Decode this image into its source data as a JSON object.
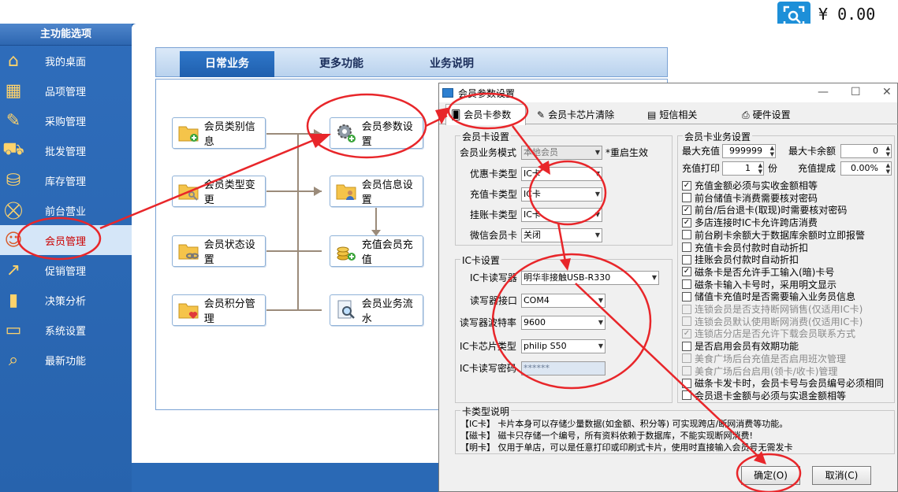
{
  "topbar": {
    "balance": "¥ 0.00"
  },
  "sidebar": {
    "title": "主功能选项",
    "items": [
      {
        "label": "我的桌面",
        "icon": "house-icon"
      },
      {
        "label": "品项管理",
        "icon": "building-icon"
      },
      {
        "label": "采购管理",
        "icon": "purchase-icon"
      },
      {
        "label": "批发管理",
        "icon": "truck-icon"
      },
      {
        "label": "库存管理",
        "icon": "database-icon"
      },
      {
        "label": "前台营业",
        "icon": "cart-icon"
      },
      {
        "label": "会员管理",
        "icon": "member-icon"
      },
      {
        "label": "促销管理",
        "icon": "promotion-icon"
      },
      {
        "label": "决策分析",
        "icon": "bar-chart-icon"
      },
      {
        "label": "系统设置",
        "icon": "computer-icon"
      },
      {
        "label": "最新功能",
        "icon": "document-search-icon"
      }
    ]
  },
  "main": {
    "tabs": [
      "日常业务",
      "更多功能",
      "业务说明"
    ],
    "buttons": [
      "会员类别信息",
      "会员类型变更",
      "会员状态设置",
      "会员积分管理",
      "会员参数设置",
      "会员信息设置",
      "充值会员充值",
      "会员业务流水"
    ]
  },
  "dialog": {
    "title": "会员参数设置",
    "tabs": [
      "会员卡参数",
      "会员卡芯片清除",
      "短信相关",
      "硬件设置"
    ],
    "card_settings": {
      "legend": "会员卡设置",
      "mode_label": "会员业务模式",
      "mode_value": "本地会员",
      "restart_note": "*重启生效",
      "discount_label": "优惠卡类型",
      "discount_value": "IC卡",
      "recharge_label": "充值卡类型",
      "recharge_value": "IC卡",
      "credit_label": "挂账卡类型",
      "credit_value": "IC卡",
      "wechat_label": "微信会员卡",
      "wechat_value": "关闭"
    },
    "ic_settings": {
      "legend": "IC卡设置",
      "reader_label": "IC卡读写器",
      "reader_value": "明华非接触USB-R330",
      "port_label": "读写器接口",
      "port_value": "COM4",
      "baud_label": "读写器波特率",
      "baud_value": "9600",
      "chip_label": "IC卡芯片类型",
      "chip_value": "philip S50",
      "password_label": "IC卡读写密码",
      "password_value": "******"
    },
    "business": {
      "legend": "会员卡业务设置",
      "max_recharge_label": "最大充值",
      "max_recharge_value": "999999",
      "max_balance_label": "最大卡余额",
      "max_balance_value": "0",
      "print_label": "充值打印",
      "print_value": "1",
      "print_unit": "份",
      "commission_label": "充值提成",
      "commission_value": "0.00%"
    },
    "checkboxes": [
      {
        "label": "充值金额必须与实收金额相等",
        "checked": true,
        "disabled": false
      },
      {
        "label": "前台储值卡消费需要核对密码",
        "checked": false,
        "disabled": false
      },
      {
        "label": "前台/后台退卡(取现)时需要核对密码",
        "checked": true,
        "disabled": false
      },
      {
        "label": "多店连接时IC卡允许跨店消费",
        "checked": true,
        "disabled": false
      },
      {
        "label": "前台刷卡余额大于数据库余额时立即报警",
        "checked": false,
        "disabled": false
      },
      {
        "label": "充值卡会员付款时自动折扣",
        "checked": false,
        "disabled": false
      },
      {
        "label": "挂账会员付款时自动折扣",
        "checked": false,
        "disabled": false
      },
      {
        "label": "磁条卡是否允许手工输入(暗)卡号",
        "checked": true,
        "disabled": false
      },
      {
        "label": "磁条卡输入卡号时，采用明文显示",
        "checked": false,
        "disabled": false
      },
      {
        "label": "储值卡充值时是否需要输入业务员信息",
        "checked": false,
        "disabled": false
      },
      {
        "label": "连锁会员是否支持断网销售(仅适用IC卡)",
        "checked": false,
        "disabled": true
      },
      {
        "label": "连锁会员默认使用断网消费(仅适用IC卡)",
        "checked": false,
        "disabled": true
      },
      {
        "label": "连锁店分店是否允许下载会员联系方式",
        "checked": true,
        "disabled": true
      },
      {
        "label": "是否启用会员有效期功能",
        "checked": false,
        "disabled": false
      },
      {
        "label": "美食广场后台充值是否启用班次管理",
        "checked": false,
        "disabled": true
      },
      {
        "label": "美食广场后台启用(领卡/收卡)管理",
        "checked": false,
        "disabled": true
      },
      {
        "label": "磁条卡发卡时，会员卡号与会员编号必须相同",
        "checked": false,
        "disabled": false
      },
      {
        "label": "会员退卡金额与必须与实退金额相等",
        "checked": false,
        "disabled": false
      }
    ],
    "card_desc": {
      "legend": "卡类型说明",
      "lines": [
        "【IC卡】 卡片本身可以存储少量数据(如金额、积分等) 可实现跨店/断网消费等功能。",
        "【磁卡】 磁卡只存储一个编号，所有资料依赖于数据库，不能实现断网消费!",
        "【明卡】 仅用于单店，可以是任意打印或印刷式卡片，使用时直接输入会员号无需发卡"
      ]
    },
    "ok_label": "确定(O)",
    "cancel_label": "取消(C)"
  },
  "colors": {
    "annotation": "#e8262a",
    "accent": "#2a69b5"
  }
}
